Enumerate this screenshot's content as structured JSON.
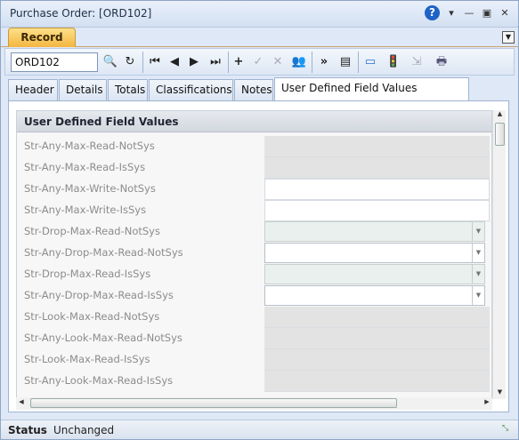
{
  "window": {
    "title": "Purchase Order: [ORD102]"
  },
  "record_tab": {
    "label": "Record"
  },
  "toolbar": {
    "record_value": "ORD102"
  },
  "tabs": [
    {
      "label": "Header"
    },
    {
      "label": "Details"
    },
    {
      "label": "Totals"
    },
    {
      "label": "Classifications"
    },
    {
      "label": "Notes"
    },
    {
      "label": "User Defined Field Values"
    }
  ],
  "section": {
    "title": "User Defined Field Values"
  },
  "fields": [
    {
      "label": "Str-Any-Max-Read-NotSys",
      "kind": "readonly"
    },
    {
      "label": "Str-Any-Max-Read-IsSys",
      "kind": "readonly"
    },
    {
      "label": "Str-Any-Max-Write-NotSys",
      "kind": "editable"
    },
    {
      "label": "Str-Any-Max-Write-IsSys",
      "kind": "editable"
    },
    {
      "label": "Str-Drop-Max-Read-NotSys",
      "kind": "drop-readonly"
    },
    {
      "label": "Str-Any-Drop-Max-Read-NotSys",
      "kind": "drop"
    },
    {
      "label": "Str-Drop-Max-Read-IsSys",
      "kind": "drop-readonly"
    },
    {
      "label": "Str-Any-Drop-Max-Read-IsSys",
      "kind": "drop"
    },
    {
      "label": "Str-Look-Max-Read-NotSys",
      "kind": "readonly"
    },
    {
      "label": "Str-Any-Look-Max-Read-NotSys",
      "kind": "readonly"
    },
    {
      "label": "Str-Look-Max-Read-IsSys",
      "kind": "readonly"
    },
    {
      "label": "Str-Any-Look-Max-Read-IsSys",
      "kind": "readonly"
    }
  ],
  "status": {
    "label": "Status",
    "value": "Unchanged"
  },
  "colors": {
    "record_tab": "#f3b640",
    "titlebar": "#d3e0f1",
    "readonly_field": "#e3e3e3"
  }
}
